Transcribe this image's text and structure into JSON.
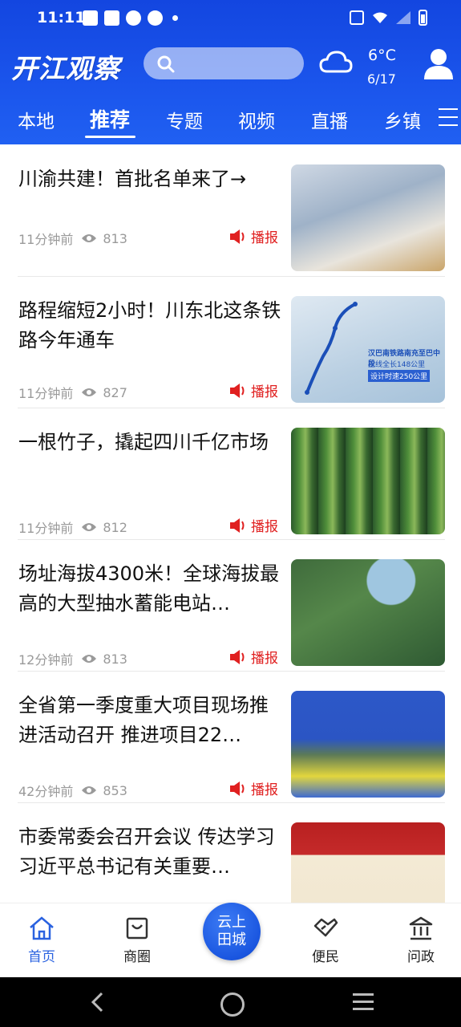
{
  "status_bar": {
    "time": "11:11"
  },
  "header": {
    "logo": "开江观察",
    "weather": {
      "temperature": "6°C",
      "date": "6/17",
      "icon": "cloud-icon"
    }
  },
  "tabs": [
    "本地",
    "推荐",
    "专题",
    "视频",
    "直播",
    "乡镇"
  ],
  "active_tab": "推荐",
  "feed": [
    {
      "title": "川渝共建！首批名单来了→",
      "time": "11分钟前",
      "views": "813",
      "play_label": "播报"
    },
    {
      "title": "路程缩短2小时！川东北这条铁路今年通车",
      "time": "11分钟前",
      "views": "827",
      "play_label": "播报",
      "thumb_text": [
        "汉巴南铁路南充至巴中段",
        "正线全长148公里",
        "设计时速250公里"
      ]
    },
    {
      "title": "一根竹子，撬起四川千亿市场",
      "time": "11分钟前",
      "views": "812",
      "play_label": "播报"
    },
    {
      "title": "场址海拔4300米！全球海拔最高的大型抽水蓄能电站…",
      "time": "12分钟前",
      "views": "813",
      "play_label": "播报"
    },
    {
      "title": "全省第一季度重大项目现场推进活动召开 推进项目22…",
      "time": "42分钟前",
      "views": "853",
      "play_label": "播报"
    },
    {
      "title": "市委常委会召开会议 传达学习习近平总书记有关重要…",
      "time": "",
      "views": "",
      "play_label": ""
    }
  ],
  "bottom_nav": {
    "home": "首页",
    "business": "商圈",
    "center_line1": "云上",
    "center_line2": "田城",
    "service": "便民",
    "gov": "问政"
  },
  "colors": {
    "brand": "#1b55ec",
    "accent_red": "#e02020",
    "active_nav": "#2a62e0"
  }
}
